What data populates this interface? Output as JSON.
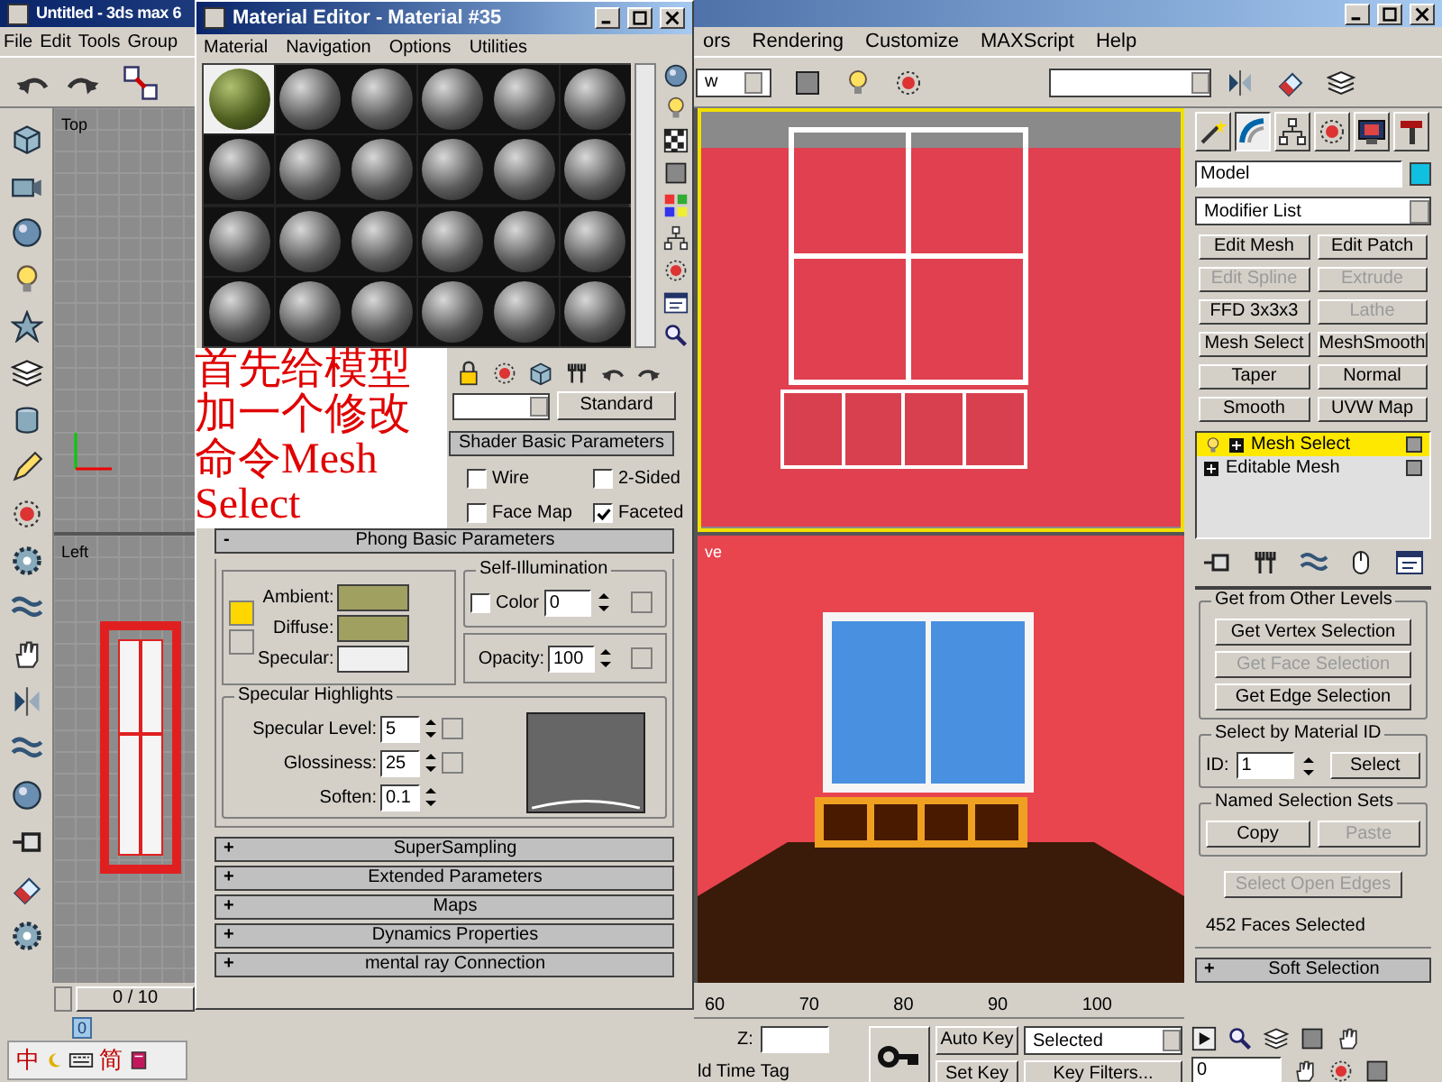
{
  "main_window": {
    "title": "Untitled - 3ds max 6",
    "menu_left": [
      "File",
      "Edit",
      "Tools",
      "Group"
    ],
    "menu_right": [
      "ors",
      "Rendering",
      "Customize",
      "MAXScript",
      "Help"
    ],
    "view_dropdown": "w"
  },
  "viewports": [
    {
      "kind": "grid",
      "label": "Top"
    },
    {
      "kind": "front"
    },
    {
      "kind": "side",
      "label": "Left"
    },
    {
      "kind": "perspective",
      "label": "ve"
    }
  ],
  "material_editor": {
    "title": "Material Editor - Material #35",
    "menu": [
      "Material",
      "Navigation",
      "Options",
      "Utilities"
    ],
    "slots": [
      {
        "selected": true
      },
      {
        "selected": false
      },
      {
        "selected": false
      },
      {
        "selected": false
      },
      {
        "selected": false
      },
      {
        "selected": false
      },
      {
        "selected": false
      },
      {
        "selected": false
      },
      {
        "selected": false
      },
      {
        "selected": false
      },
      {
        "selected": false
      },
      {
        "selected": false
      },
      {
        "selected": false
      },
      {
        "selected": false
      },
      {
        "selected": false
      },
      {
        "selected": false
      },
      {
        "selected": false
      },
      {
        "selected": false
      },
      {
        "selected": false
      },
      {
        "selected": false
      },
      {
        "selected": false
      },
      {
        "selected": false
      },
      {
        "selected": false
      },
      {
        "selected": false
      }
    ],
    "type_button": "Standard",
    "shader_rollout": {
      "title": "Shader Basic Parameters",
      "options": [
        {
          "label": "Wire",
          "checked": false
        },
        {
          "label": "2-Sided",
          "checked": false
        },
        {
          "label": "Face Map",
          "checked": false
        },
        {
          "label": "Faceted",
          "checked": true
        }
      ]
    },
    "phong_rollout": {
      "sign": "-",
      "title": "Phong Basic Parameters",
      "colors": [
        {
          "label": "Ambient:",
          "color": "#a0a060"
        },
        {
          "label": "Diffuse:",
          "color": "#a0a060"
        },
        {
          "label": "Specular:",
          "color": "#f0f0f0"
        }
      ],
      "self_illumination": {
        "title": "Self-Illumination",
        "label": "Color",
        "checked": false,
        "value": "0"
      },
      "opacity": {
        "label": "Opacity:",
        "value": "100"
      },
      "specular_highlights": {
        "title": "Specular Highlights",
        "fields": [
          {
            "label": "Specular Level:",
            "value": "5"
          },
          {
            "label": "Glossiness:",
            "value": "25"
          },
          {
            "label": "Soften:",
            "value": "0.1"
          }
        ]
      }
    },
    "collapsed_rollouts": [
      {
        "sign": "+",
        "title": "SuperSampling"
      },
      {
        "sign": "+",
        "title": "Extended Parameters"
      },
      {
        "sign": "+",
        "title": "Maps"
      },
      {
        "sign": "+",
        "title": "Dynamics Properties"
      },
      {
        "sign": "+",
        "title": "mental ray Connection"
      }
    ]
  },
  "annotation": "首先给模型加一个修改命令Mesh Select",
  "command_panel": {
    "tabs": [
      {
        "kind": "create",
        "selected": false
      },
      {
        "kind": "modify",
        "selected": true
      },
      {
        "kind": "hierarchy",
        "selected": false
      },
      {
        "kind": "motion",
        "selected": false
      },
      {
        "kind": "display",
        "selected": false
      },
      {
        "kind": "utilities",
        "selected": false
      }
    ],
    "object_name": "Model",
    "modifier_list": "Modifier List",
    "modifier_buttons": [
      {
        "label": "Edit Mesh",
        "disabled": false
      },
      {
        "label": "Edit Patch",
        "disabled": false
      },
      {
        "label": "Edit Spline",
        "disabled": true
      },
      {
        "label": "Extrude",
        "disabled": true
      },
      {
        "label": "FFD 3x3x3",
        "disabled": false
      },
      {
        "label": "Lathe",
        "disabled": true
      },
      {
        "label": "Mesh Select",
        "disabled": false
      },
      {
        "label": "MeshSmooth",
        "disabled": false
      },
      {
        "label": "Taper",
        "disabled": false
      },
      {
        "label": "Normal",
        "disabled": false
      },
      {
        "label": "Smooth",
        "disabled": false
      },
      {
        "label": "UVW Map",
        "disabled": false
      }
    ],
    "stack": [
      {
        "label": "Mesh Select",
        "selected": true
      },
      {
        "label": "Editable Mesh",
        "selected": false
      }
    ],
    "get_from_other_levels": {
      "title": "Get from Other Levels",
      "buttons": [
        {
          "label": "Get Vertex Selection",
          "disabled": false
        },
        {
          "label": "Get Face Selection",
          "disabled": true
        },
        {
          "label": "Get Edge Selection",
          "disabled": false
        }
      ]
    },
    "material_id": {
      "title": "Select by Material ID",
      "label": "ID:",
      "value": "1",
      "button": "Select"
    },
    "named_selection_sets": {
      "title": "Named Selection Sets",
      "buttons": [
        {
          "label": "Copy",
          "disabled": false
        },
        {
          "label": "Paste",
          "disabled": true
        }
      ]
    },
    "select_open_edges": {
      "label": "Select Open Edges",
      "disabled": true
    },
    "status": "452 Faces Selected",
    "soft_selection": {
      "sign": "+",
      "title": "Soft Selection"
    }
  },
  "timeline": {
    "slider": "0 / 10",
    "track_frame": "0",
    "ruler": [
      "60",
      "70",
      "80",
      "90",
      "100"
    ]
  },
  "status_bar": {
    "time_tag": "ld Time Tag",
    "z_label": "Z:",
    "auto_key": "Auto Key",
    "set_key": "Set Key",
    "key_mode": "Selected",
    "key_filters": "Key Filters...",
    "frame": "0"
  },
  "ime_bar": [
    "中",
    "简"
  ]
}
